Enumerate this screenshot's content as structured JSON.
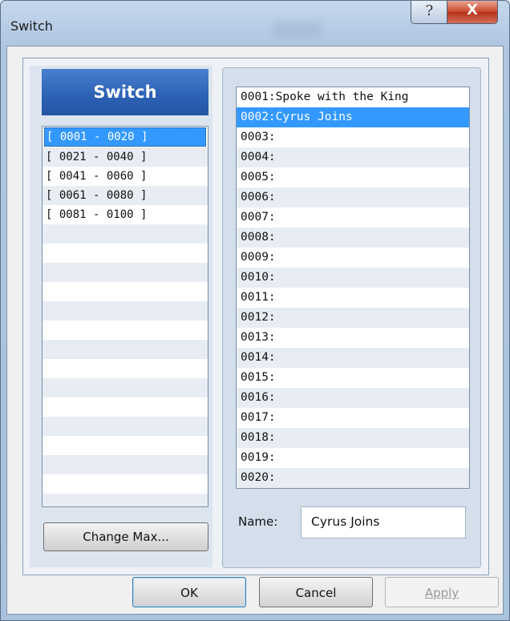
{
  "window": {
    "title": "Switch"
  },
  "titlebar": {
    "help_glyph": "?",
    "close_glyph": "X"
  },
  "panel": {
    "header": "Switch"
  },
  "ranges": [
    "[ 0001 - 0020 ]",
    "[ 0021 - 0040 ]",
    "[ 0041 - 0060 ]",
    "[ 0061 - 0080 ]",
    "[ 0081 - 0100 ]"
  ],
  "selected_range_index": 0,
  "switches": [
    "0001:Spoke with the King",
    "0002:Cyrus Joins",
    "0003:",
    "0004:",
    "0005:",
    "0006:",
    "0007:",
    "0008:",
    "0009:",
    "0010:",
    "0011:",
    "0012:",
    "0013:",
    "0014:",
    "0015:",
    "0016:",
    "0017:",
    "0018:",
    "0019:",
    "0020:"
  ],
  "selected_switch_index": 1,
  "name_field": {
    "label": "Name:",
    "value": "Cyrus Joins"
  },
  "buttons": {
    "change_max": "Change Max...",
    "ok": "OK",
    "cancel": "Cancel",
    "apply": "Apply"
  },
  "colors": {
    "selection": "#3399ff",
    "header": "#2b60b3"
  }
}
